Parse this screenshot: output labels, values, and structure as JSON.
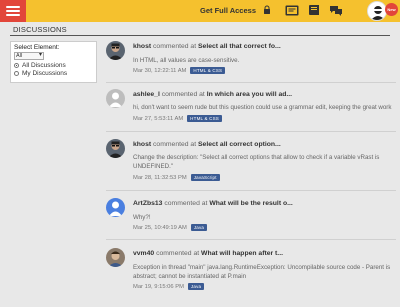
{
  "header": {
    "full_access_label": "Get Full Access",
    "new_badge": "New",
    "colors": {
      "bar": "#f5c12e",
      "menu": "#e2463a"
    }
  },
  "section_title": "DISCUSSIONS",
  "filter": {
    "label": "Select Element:",
    "select_value": "All",
    "options": [
      {
        "label": "All Discussions",
        "selected": true
      },
      {
        "label": "My Discussions",
        "selected": false
      }
    ]
  },
  "posts": [
    {
      "user": "khost",
      "action": "commented at",
      "title": "Select all that correct fo...",
      "body": "In HTML, all values are case-sensitive.",
      "date": "Mar 30, 12:22:11 AM",
      "tag": "HTML & CSS",
      "tag_color": "#3b5b93",
      "avatar": "khost-avatar"
    },
    {
      "user": "ashlee_l",
      "action": "commented at",
      "title": "In which area you will ad...",
      "body": "hi, don't want to seem rude but this question could use a grammar edit, keeping the great work",
      "date": "Mar 27, 5:53:11 AM",
      "tag": "HTML & CSS",
      "tag_color": "#3b5b93",
      "avatar": "default-avatar"
    },
    {
      "user": "khost",
      "action": "commented at",
      "title": "Select all correct option...",
      "body": "Change the description: \"Select all correct options that allow to check if a variable vRast is UNDEFINED.\"",
      "date": "Mar 28, 11:32:53 PM",
      "tag": "JavaScript",
      "tag_color": "#3b5b93",
      "avatar": "khost-avatar"
    },
    {
      "user": "ArtZbs13",
      "action": "commented at",
      "title": "What will be the result o...",
      "body": "Why?!",
      "date": "Mar 25, 10:49:19 AM",
      "tag": "Java",
      "tag_color": "#3b5b93",
      "avatar": "google-avatar"
    },
    {
      "user": "vvm40",
      "action": "commented at",
      "title": "What will happen after t...",
      "body": "Exception in thread \"main\" java.lang.RuntimeException: Uncompilable source code - Parent is abstract; cannot be instantiated at P.main",
      "date": "Mar 19, 9:15:06 PM",
      "tag": "Java",
      "tag_color": "#3b5b93",
      "avatar": "photo-avatar"
    }
  ]
}
